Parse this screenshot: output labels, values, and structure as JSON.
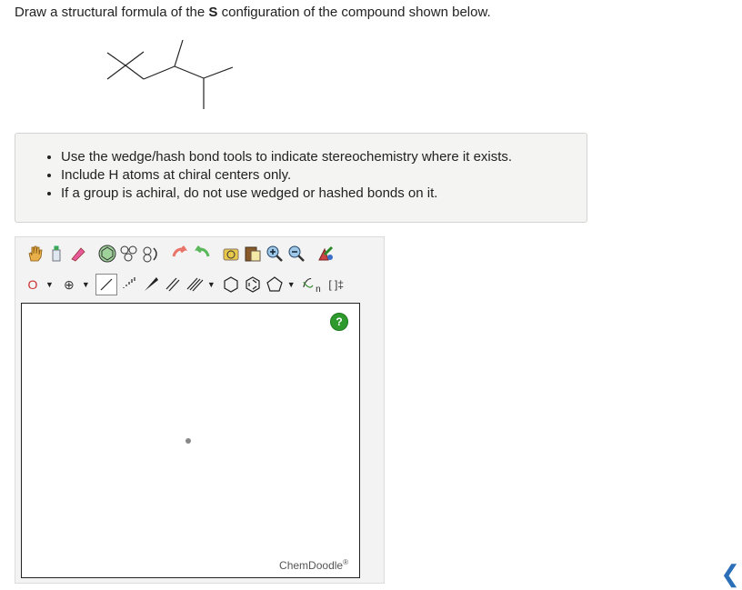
{
  "question": {
    "prefix": "Draw a structural formula of the ",
    "bold": "S",
    "suffix": " configuration of the compound shown below."
  },
  "instructions": [
    "Use the wedge/hash bond tools to indicate stereochemistry where it exists.",
    "Include H atoms at chiral centers only.",
    "If a group is achiral, do not use wedged or hashed bonds on it."
  ],
  "toolbar": {
    "row1": [
      "hand-icon",
      "lasso-icon",
      "eraser-icon",
      "ring-template-icon",
      "template-icon",
      "rotate-icon",
      "undo-icon",
      "redo-icon",
      "copy-icon",
      "paste-icon",
      "zoom-in-icon",
      "zoom-out-icon",
      "clean-icon"
    ],
    "element_label": "O",
    "charge_label": "⊕",
    "bracket_label": "[ ]‡",
    "sgroup_label": "n"
  },
  "canvas": {
    "help_label": "?",
    "brand": "ChemDoodle",
    "brand_mark": "®"
  },
  "nav": {
    "next_label": "❮"
  }
}
